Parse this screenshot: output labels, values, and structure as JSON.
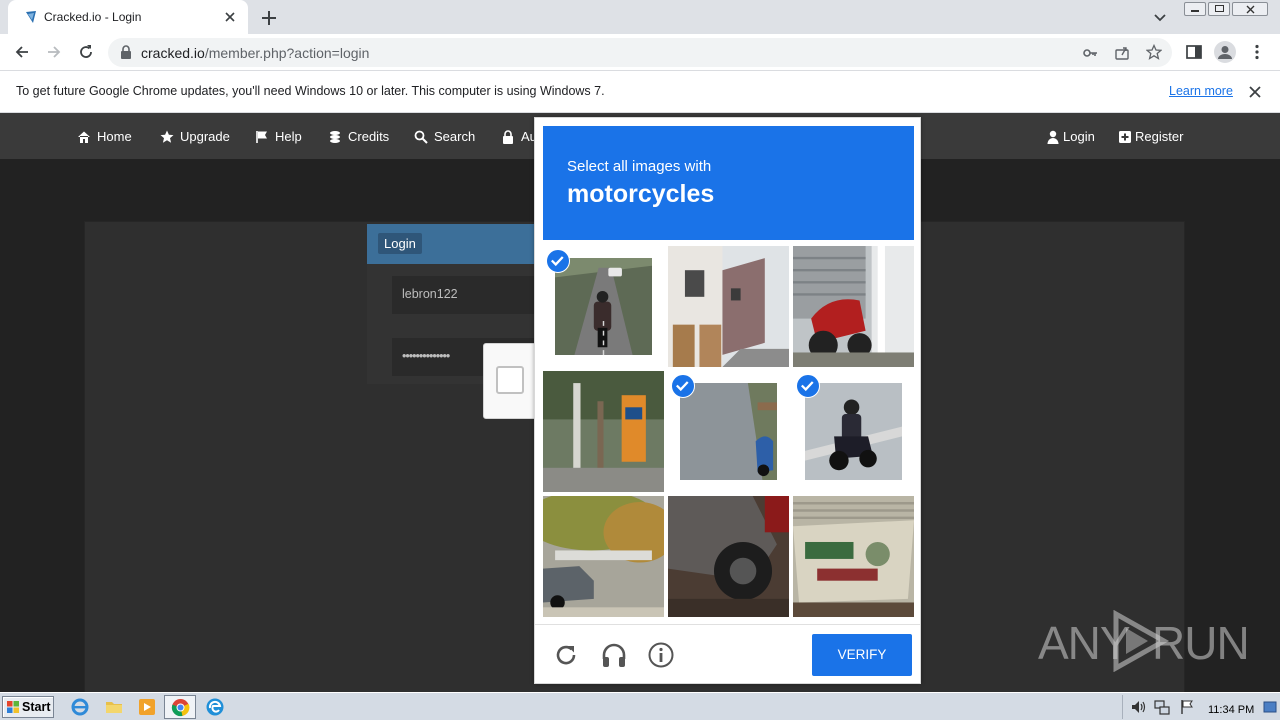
{
  "browser": {
    "tab_title": "Cracked.io - Login",
    "url_domain": "cracked.io",
    "url_path": "/member.php?action=login",
    "infobar_message": "To get future Google Chrome updates, you'll need Windows 10 or later. This computer is using Windows 7.",
    "infobar_link": "Learn more"
  },
  "site": {
    "nav": [
      {
        "label": "Home",
        "icon": "home-icon"
      },
      {
        "label": "Upgrade",
        "icon": "star-icon"
      },
      {
        "label": "Help",
        "icon": "flag-icon"
      },
      {
        "label": "Credits",
        "icon": "coins-icon"
      },
      {
        "label": "Search",
        "icon": "search-icon"
      },
      {
        "label": "Au",
        "icon": "lock-icon"
      }
    ],
    "nav_right": [
      {
        "label": "Login",
        "icon": "user-icon"
      },
      {
        "label": "Register",
        "icon": "plus-square-icon"
      }
    ],
    "login_heading": "Login",
    "username_value": "lebron122",
    "password_value": "••••••••••••••"
  },
  "captcha": {
    "prompt": "Select all images with",
    "target": "motorcycles",
    "verify_label": "VERIFY",
    "tiles": [
      {
        "name": "tile-1",
        "selected": true
      },
      {
        "name": "tile-2",
        "selected": false
      },
      {
        "name": "tile-3",
        "selected": false
      },
      {
        "name": "tile-4",
        "selected": false
      },
      {
        "name": "tile-5",
        "selected": true
      },
      {
        "name": "tile-6",
        "selected": true
      },
      {
        "name": "tile-7",
        "selected": false
      },
      {
        "name": "tile-8",
        "selected": false
      },
      {
        "name": "tile-9",
        "selected": false
      }
    ],
    "accent_color": "#1a73e8"
  },
  "watermark": {
    "left": "ANY",
    "right": "RUN"
  },
  "taskbar": {
    "start_label": "Start",
    "clock": "11:34 PM"
  }
}
